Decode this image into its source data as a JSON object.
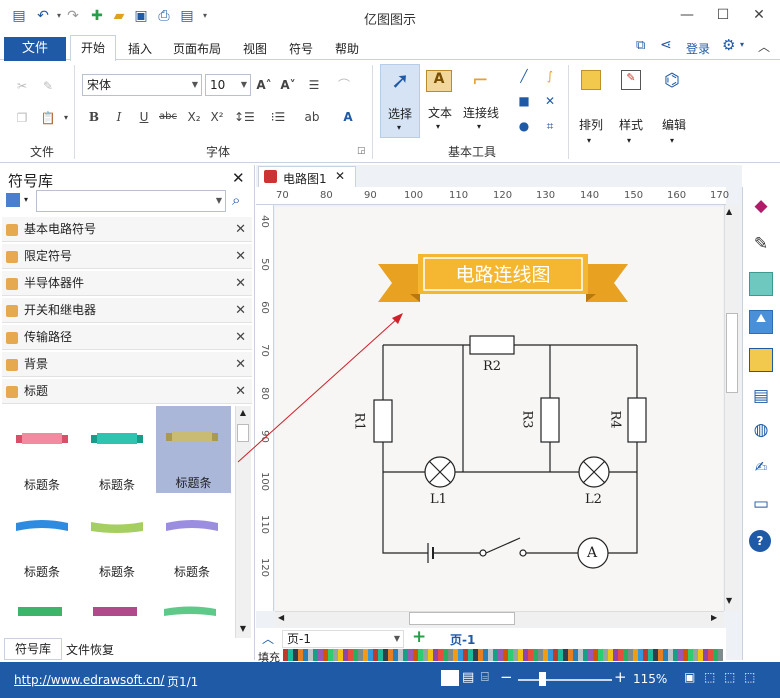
{
  "app": {
    "title": "亿图图示"
  },
  "quick_access": [
    "save-icon",
    "undo-icon",
    "redo-icon",
    "new-icon",
    "open-icon",
    "save-icon",
    "print-icon",
    "export-icon",
    "more-icon"
  ],
  "menu": {
    "file": "文件",
    "tabs": [
      "开始",
      "插入",
      "页面布局",
      "视图",
      "符号",
      "帮助"
    ],
    "login": "登录"
  },
  "ribbon": {
    "file_group": "文件",
    "font_group": "字体",
    "font_name": "宋体",
    "font_size": "10",
    "basic_tools_group": "基本工具",
    "select": "选择",
    "text": "文本",
    "connector": "连接线",
    "arrange": "排列",
    "style": "样式",
    "edit": "编辑"
  },
  "library": {
    "title": "符号库",
    "search_placeholder": "",
    "items": [
      "基本电路符号",
      "限定符号",
      "半导体器件",
      "开关和继电器",
      "传输路径",
      "背景",
      "标题"
    ],
    "thumbs": [
      "标题条",
      "标题条",
      "标题条",
      "标题条",
      "标题条",
      "标题条"
    ],
    "bottom_tabs": [
      "符号库",
      "文件恢复"
    ]
  },
  "document": {
    "tab": "电路图1",
    "banner_text": "电路连线图",
    "labels": {
      "r1": "R1",
      "r2": "R2",
      "r3": "R3",
      "r4": "R4",
      "l1": "L1",
      "l2": "L2",
      "ammeter": "A"
    },
    "ruler_h": [
      "70",
      "80",
      "90",
      "100",
      "110",
      "120",
      "130",
      "140",
      "150",
      "160",
      "170"
    ],
    "ruler_v": [
      "40",
      "50",
      "60",
      "70",
      "80",
      "90",
      "100",
      "110",
      "120"
    ]
  },
  "pagebar": {
    "page_select": "页-1",
    "page_tab": "页-1",
    "fill_label": "填充"
  },
  "status": {
    "url": "http://www.edrawsoft.cn/",
    "page": "页1/1",
    "zoom": "115%"
  },
  "colors": {
    "accent": "#1f5aa6",
    "banner": "#f5b731",
    "wire": "#222222"
  }
}
